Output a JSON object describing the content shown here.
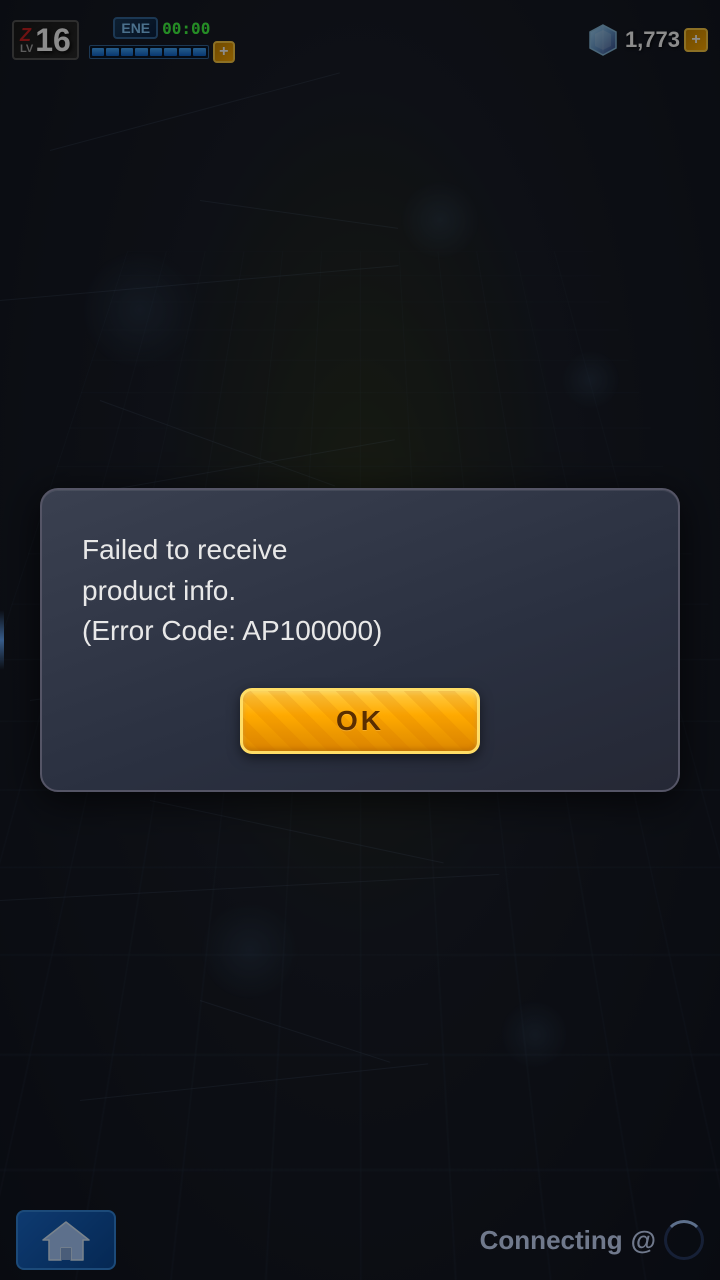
{
  "game": {
    "level": {
      "prefix": "Z",
      "suffix": "LV",
      "value": "16"
    },
    "energy": {
      "label": "ENE",
      "timer": "00:00",
      "segments": 8,
      "filled": 8,
      "plus_label": "+"
    },
    "gems": {
      "count": "1,773",
      "plus_label": "+"
    }
  },
  "dialog": {
    "message": "Failed to receive product info.\n(Error Code: AP100000)",
    "ok_button": "OK"
  },
  "bottom": {
    "connecting_text": "Connecting",
    "connecting_suffix": "@"
  }
}
